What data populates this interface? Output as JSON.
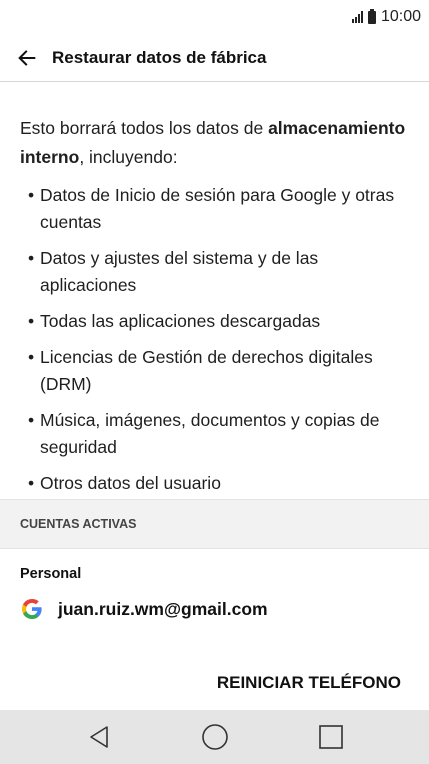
{
  "status_bar": {
    "time": "10:00",
    "signal_icon": "signal-bars-icon",
    "battery_icon": "battery-icon"
  },
  "app_bar": {
    "back_icon": "back-arrow-icon",
    "title": "Restaurar datos de fábrica"
  },
  "intro": {
    "text_before": "Esto borrará todos los datos de ",
    "bold_text": "almacenamiento interno",
    "text_after": ", incluyendo:"
  },
  "items": [
    "Datos de Inicio de sesión para Google y otras cuentas",
    "Datos y ajustes del sistema y de las aplicaciones",
    "Todas las aplicaciones descargadas",
    "Licencias de Gestión de derechos digitales (DRM)",
    "Música, imágenes, documentos y copias de seguridad",
    "Otros datos del usuario"
  ],
  "accounts": {
    "header": "CUENTAS ACTIVAS",
    "group": "Personal",
    "email": "juan.ruiz.wm@gmail.com",
    "icon": "google-icon"
  },
  "reset_button": "REINICIAR TELÉFONO",
  "nav": {
    "back": "nav-back-icon",
    "home": "nav-home-icon",
    "recents": "nav-recents-icon"
  }
}
